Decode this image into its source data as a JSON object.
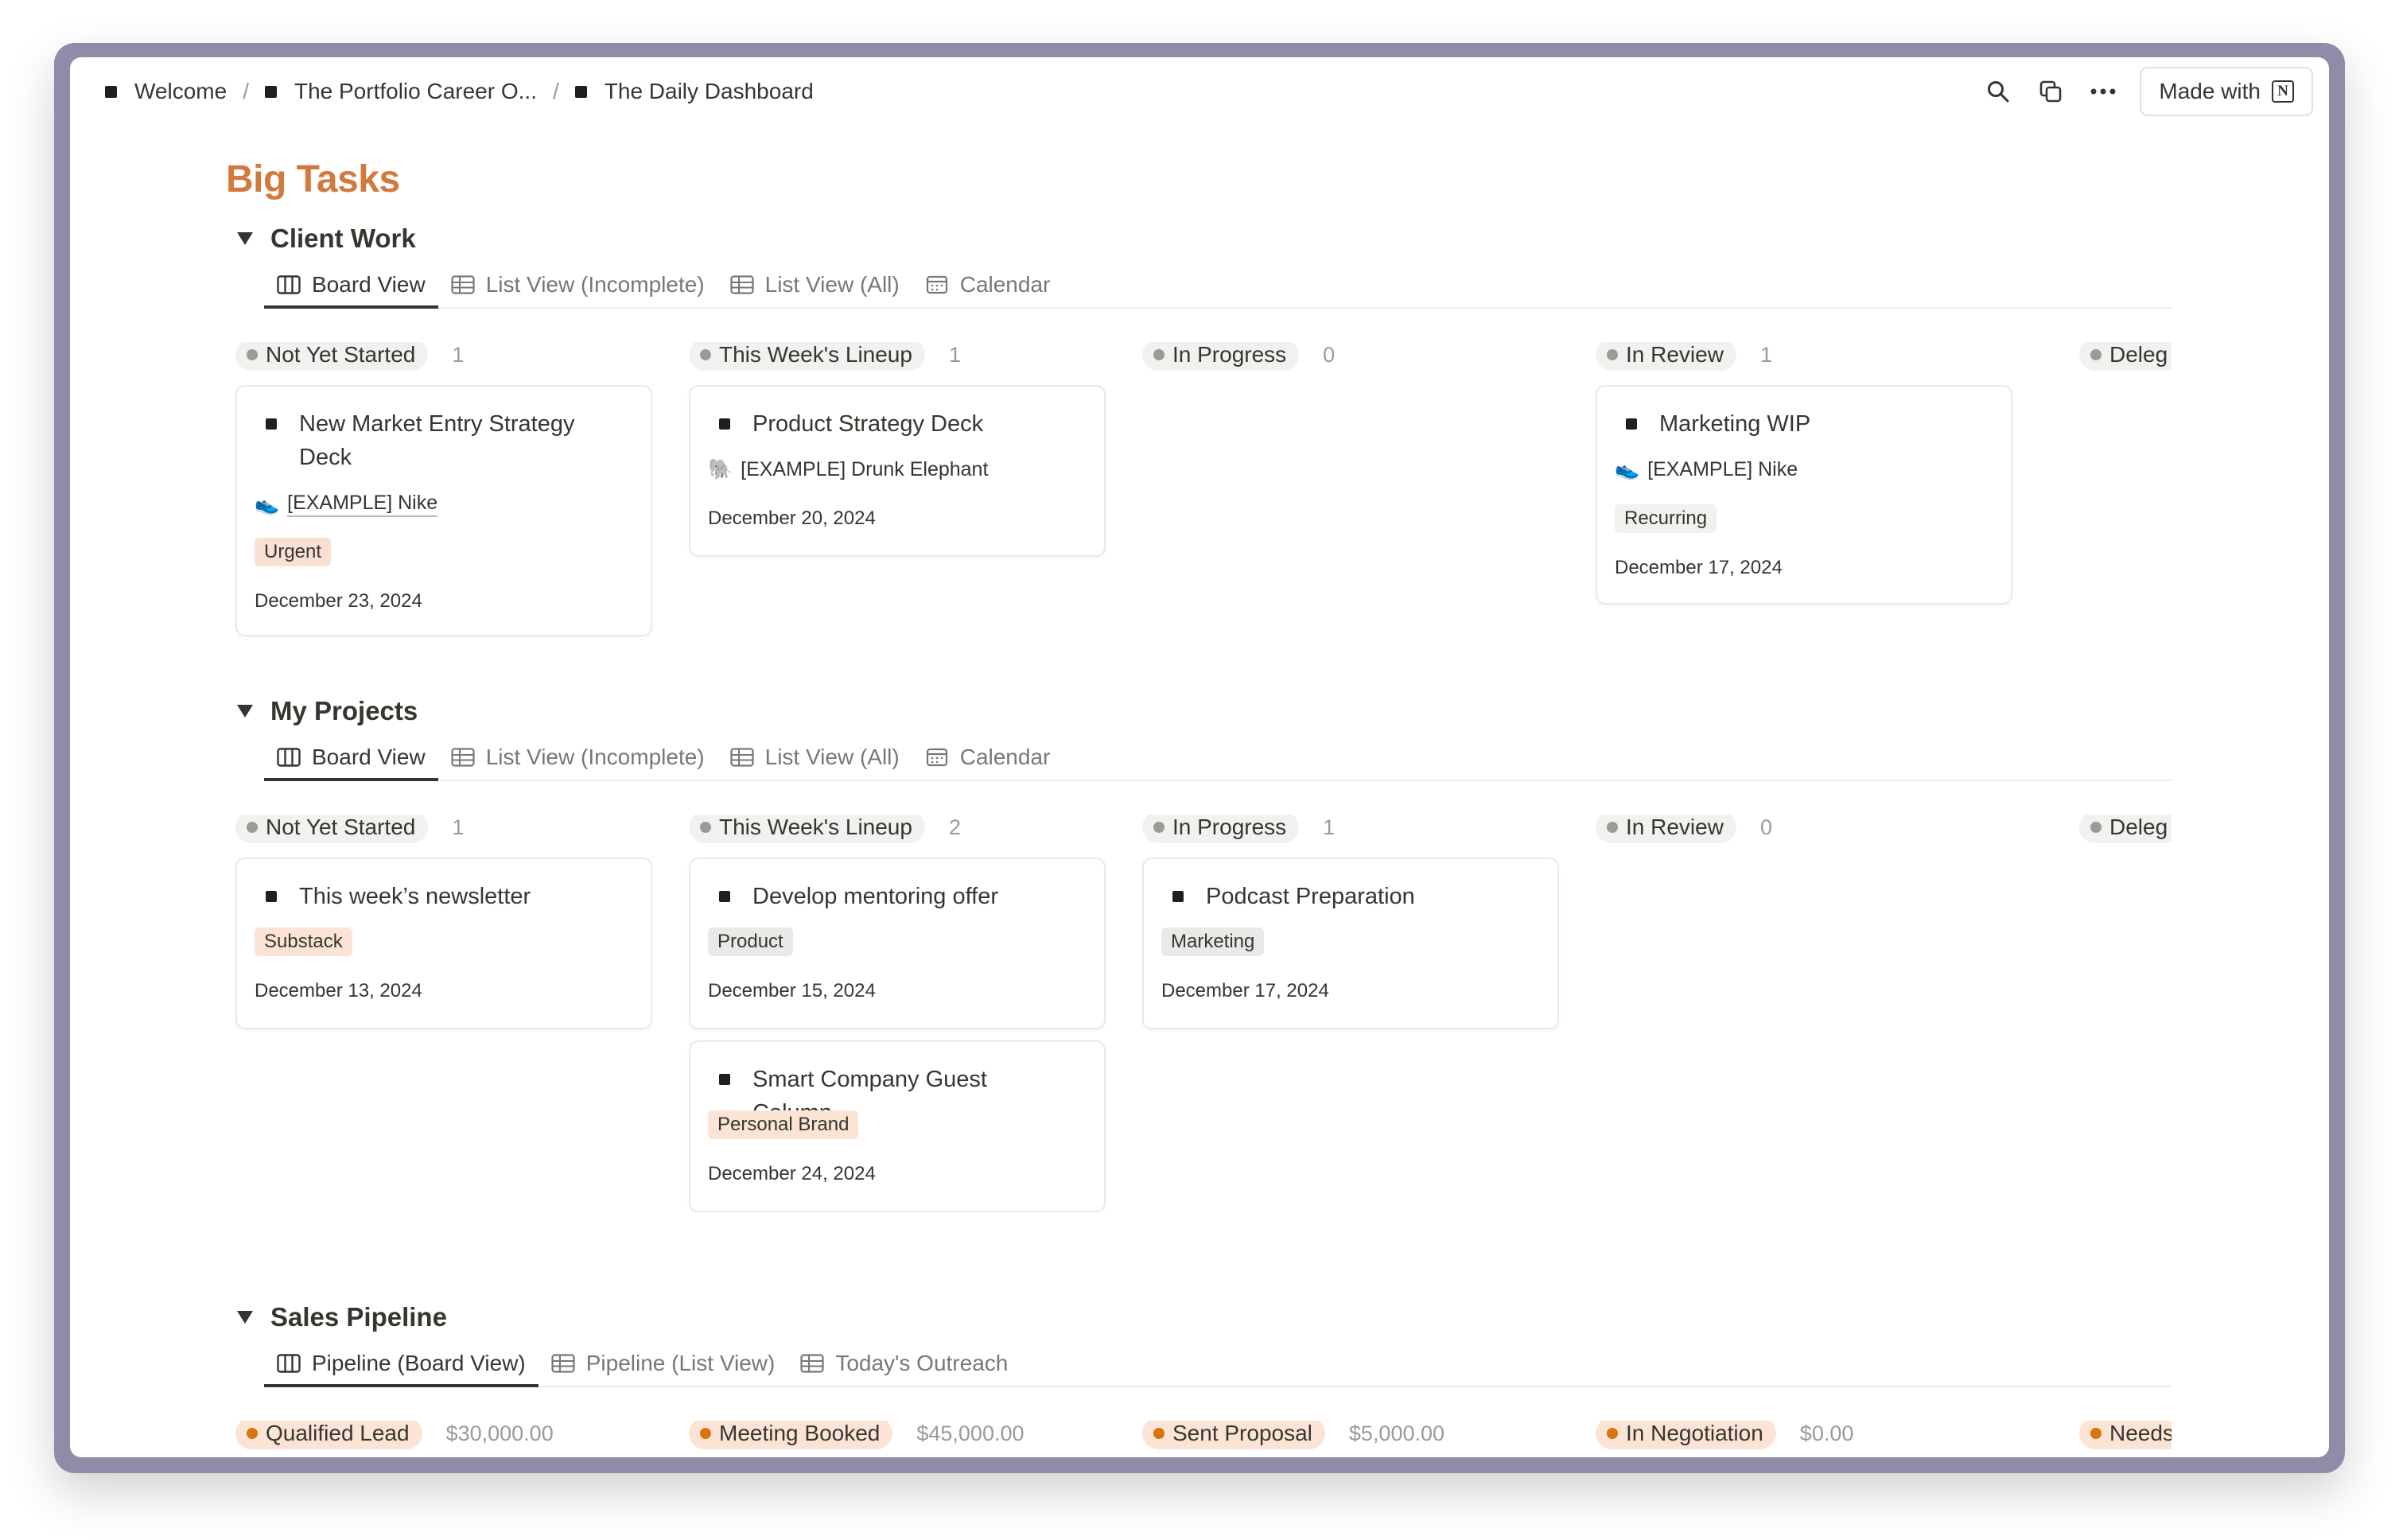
{
  "breadcrumb": {
    "items": [
      "Welcome",
      "The Portfolio Career O...",
      "The Daily Dashboard"
    ],
    "separator": "/"
  },
  "toolbar": {
    "icons": [
      "search-icon",
      "duplicate-icon",
      "more-icon"
    ],
    "made_with_label": "Made with",
    "logo_letter": "N"
  },
  "page": {
    "title": "Big Tasks"
  },
  "colors": {
    "title_accent": "#d3793d",
    "tag_urgent": "#fadfd4",
    "tag_gray": "#e9e9e7",
    "tag_orange": "#fbe4d6",
    "status_gray": "#f1f1ef",
    "status_orange": "#fbe4d6",
    "dot_orange": "#d9730d"
  },
  "client_work": {
    "title": "Client Work",
    "tabs": [
      "Board View",
      "List View (Incomplete)",
      "List View (All)",
      "Calendar"
    ],
    "columns": [
      {
        "name": "Not Yet Started",
        "count": "1"
      },
      {
        "name": "This Week's Lineup",
        "count": "1"
      },
      {
        "name": "In Progress",
        "count": "0"
      },
      {
        "name": "In Review",
        "count": "1"
      },
      {
        "name": "Deleg"
      }
    ],
    "cards": [
      {
        "title": "New Market Entry Strategy Deck",
        "relation": "[EXAMPLE] Nike",
        "relation_icon": "shoe-icon",
        "tag": "Urgent",
        "date": "December 23, 2024"
      },
      {
        "title": "Product Strategy Deck",
        "relation": "[EXAMPLE] Drunk Elephant",
        "relation_icon": "elephant-icon",
        "date": "December 20, 2024"
      },
      {
        "title": "Marketing WIP",
        "relation": "[EXAMPLE] Nike",
        "relation_icon": "shoe-icon",
        "tag": "Recurring",
        "date": "December 17, 2024"
      }
    ]
  },
  "my_projects": {
    "title": "My Projects",
    "tabs": [
      "Board View",
      "List View (Incomplete)",
      "List View (All)",
      "Calendar"
    ],
    "columns": [
      {
        "name": "Not Yet Started",
        "count": "1"
      },
      {
        "name": "This Week's Lineup",
        "count": "2"
      },
      {
        "name": "In Progress",
        "count": "1"
      },
      {
        "name": "In Review",
        "count": "0"
      },
      {
        "name": "Deleg"
      }
    ],
    "cards": [
      {
        "title": "This week’s newsletter",
        "tag": "Substack",
        "date": "December 13, 2024"
      },
      {
        "title": "Develop mentoring offer",
        "tag": "Product",
        "date": "December 15, 2024"
      },
      {
        "title": "Smart Company Guest Column",
        "tag": "Personal Brand",
        "date": "December 24, 2024"
      },
      {
        "title": "Podcast Preparation",
        "tag": "Marketing",
        "date": "December 17, 2024"
      }
    ]
  },
  "sales_pipeline": {
    "title": "Sales Pipeline",
    "tabs": [
      "Pipeline (Board View)",
      "Pipeline (List View)",
      "Today's Outreach"
    ],
    "columns": [
      {
        "name": "Qualified Lead",
        "amount": "$30,000.00"
      },
      {
        "name": "Meeting Booked",
        "amount": "$45,000.00"
      },
      {
        "name": "Sent Proposal",
        "amount": "$5,000.00"
      },
      {
        "name": "In Negotiation",
        "amount": "$0.00"
      },
      {
        "name": "Needs"
      }
    ]
  }
}
